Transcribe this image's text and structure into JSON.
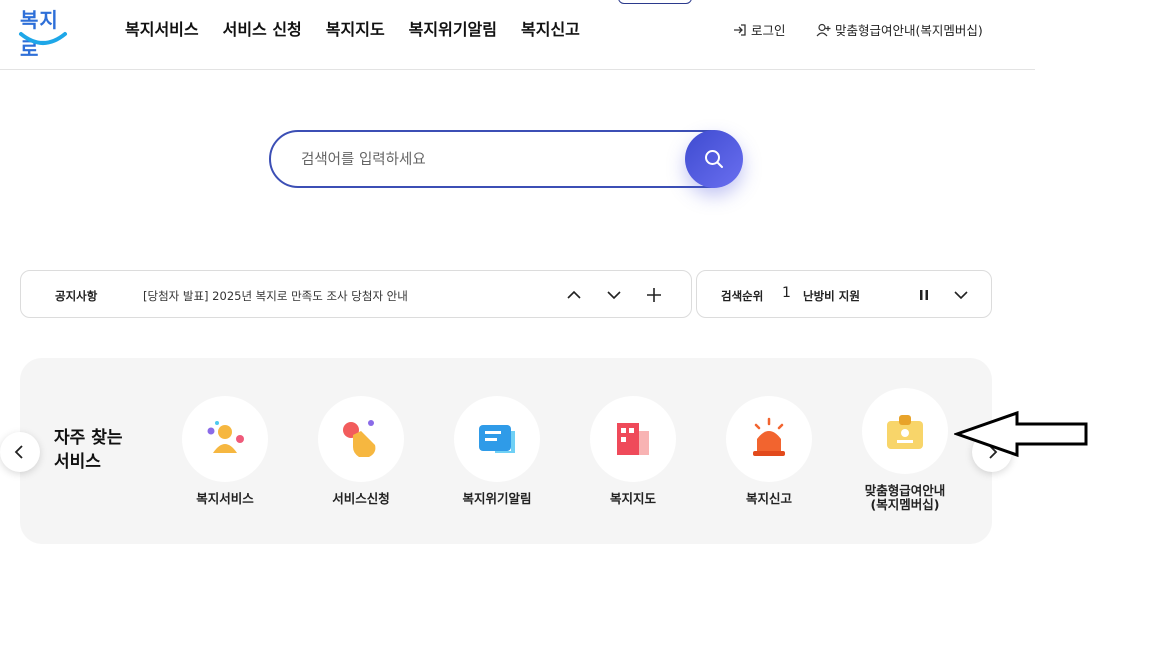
{
  "header": {
    "logo_text": "복지로",
    "nav": [
      "복지서비스",
      "서비스 신청",
      "복지지도",
      "복지위기알림",
      "복지신고"
    ],
    "login_label": "로그인",
    "membership_label": "맞춤형급여안내(복지멤버십)"
  },
  "search": {
    "placeholder": "검색어를 입력하세요"
  },
  "notice": {
    "label": "공지사항",
    "text": "[당첨자 발표] 2025년 복지로 만족도 조사 당첨자 안내"
  },
  "ranking": {
    "label": "검색순위",
    "number": "1",
    "keyword": "난방비 지원"
  },
  "frequent": {
    "title_line1": "자주 찾는",
    "title_line2": "서비스",
    "items": [
      {
        "label": "복지서비스",
        "icon": "people-icon"
      },
      {
        "label": "서비스신청",
        "icon": "hand-tap-icon"
      },
      {
        "label": "복지위기알림",
        "icon": "message-icon"
      },
      {
        "label": "복지지도",
        "icon": "building-icon"
      },
      {
        "label": "복지신고",
        "icon": "siren-icon"
      },
      {
        "label": "맞춤형급여안내\n(복지멤버십)",
        "label_line1": "맞춤형급여안내",
        "label_line2": "(복지멤버십)",
        "icon": "id-card-icon"
      }
    ]
  },
  "colors": {
    "accent": "#3c4fb5",
    "search_button": "#5a5fe6",
    "panel_bg": "#f5f5f5"
  }
}
